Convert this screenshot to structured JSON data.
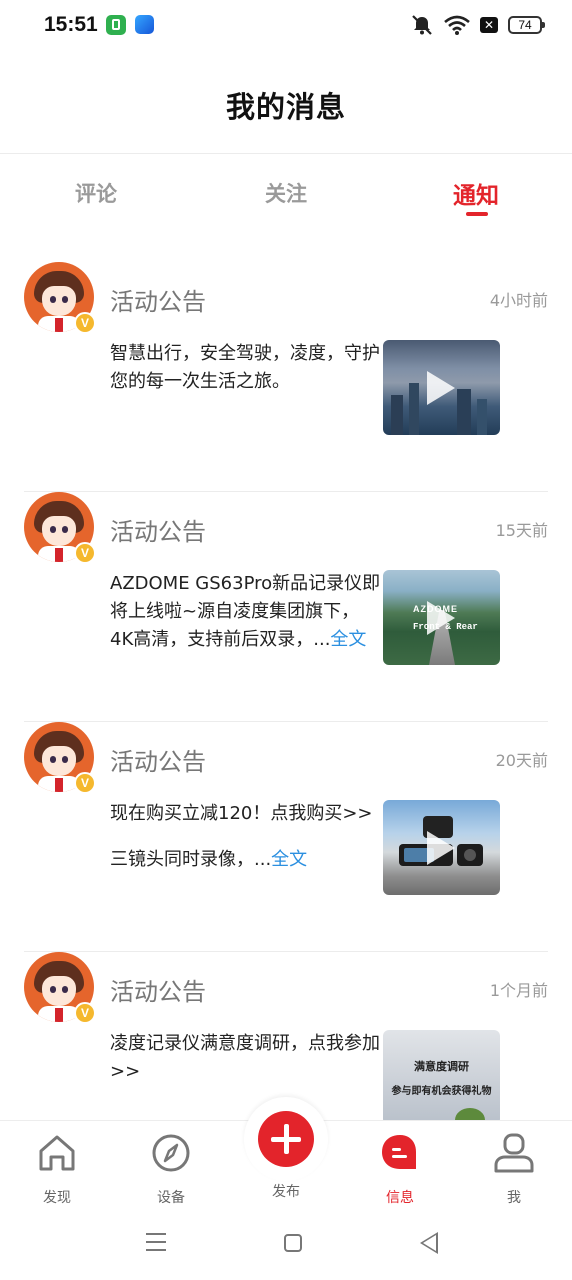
{
  "status_bar": {
    "time": "15:51",
    "battery": "74",
    "icons": [
      "app-green-icon",
      "app-blue-icon",
      "mute-vibrate-icon",
      "wifi-icon",
      "sim-off-icon",
      "battery-icon"
    ]
  },
  "header": {
    "title": "我的消息"
  },
  "tabs": [
    {
      "label": "评论"
    },
    {
      "label": "关注"
    },
    {
      "label": "通知",
      "active": true
    }
  ],
  "messages": [
    {
      "title": "活动公告",
      "time": "4小时前",
      "body": "智慧出行，安全驾驶，凌度，守护您的每一次生活之旅。",
      "more": "",
      "thumb": "city-skyline-video"
    },
    {
      "title": "活动公告",
      "time": "15天前",
      "body": "AZDOME GS63Pro新品记录仪即将上线啦~源自凌度集团旗下，4K高清，支持前后双录，...",
      "more": "全文",
      "thumb": "azdome-front-rear-video",
      "thumb_text": {
        "brand": "AZDOME",
        "caption": "Front & Rear"
      }
    },
    {
      "title": "活动公告",
      "time": "20天前",
      "body_line1": "现在购买立减120！点我购买>>",
      "body_line2": "三镜头同时录像，...",
      "more": "全文",
      "thumb": "three-lens-dashcam-video"
    },
    {
      "title": "活动公告",
      "time": "1个月前",
      "body": "凌度记录仪满意度调研，点我参加>>",
      "more": "",
      "thumb": "survey-image",
      "thumb_text": {
        "line1": "满意度调研",
        "line2": "参与即有机会获得礼物"
      }
    }
  ],
  "bottom_nav": [
    {
      "label": "发现",
      "icon": "home-icon"
    },
    {
      "label": "设备",
      "icon": "compass-icon"
    },
    {
      "label": "发布",
      "icon": "plus-icon"
    },
    {
      "label": "信息",
      "icon": "message-icon",
      "active": true
    },
    {
      "label": "我",
      "icon": "profile-icon"
    }
  ],
  "colors": {
    "accent": "#e3242b",
    "link": "#2b8fe0",
    "muted": "#9a9a9a"
  }
}
